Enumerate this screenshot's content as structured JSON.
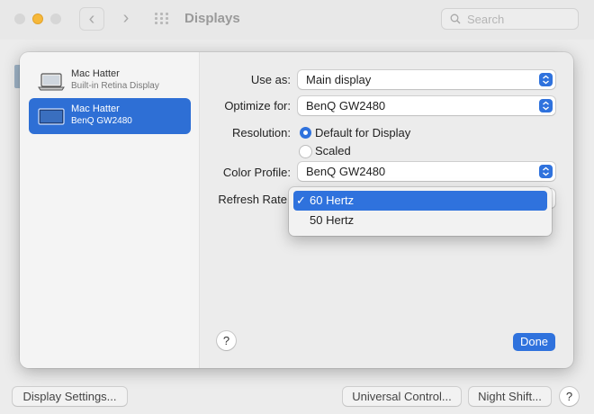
{
  "window": {
    "title": "Displays",
    "search_placeholder": "Search",
    "back_icon": "‹",
    "forward_icon": "›"
  },
  "sidebar": {
    "items": [
      {
        "name": "Mac Hatter",
        "subtitle": "Built-in Retina Display",
        "icon": "laptop-icon",
        "selected": false
      },
      {
        "name": "Mac Hatter",
        "subtitle": "BenQ GW2480",
        "icon": "monitor-icon",
        "selected": true
      }
    ]
  },
  "settings": {
    "use_as": {
      "label": "Use as:",
      "value": "Main display"
    },
    "optimize_for": {
      "label": "Optimize for:",
      "value": "BenQ GW2480"
    },
    "resolution": {
      "label": "Resolution:",
      "options": [
        "Default for Display",
        "Scaled"
      ],
      "selected": "Default for Display"
    },
    "color_profile": {
      "label": "Color Profile:",
      "value": "BenQ GW2480"
    },
    "refresh_rate": {
      "label": "Refresh Rate",
      "options": [
        "60 Hertz",
        "50 Hertz"
      ],
      "selected": "60 Hertz",
      "check": "✓"
    }
  },
  "sheet_buttons": {
    "help": "?",
    "done": "Done"
  },
  "bottom_bar": {
    "display_settings": "Display Settings...",
    "universal_control": "Universal Control...",
    "night_shift": "Night Shift...",
    "help": "?"
  },
  "colors": {
    "accent": "#2f72dd",
    "selected_row": "#2e6fd5"
  }
}
